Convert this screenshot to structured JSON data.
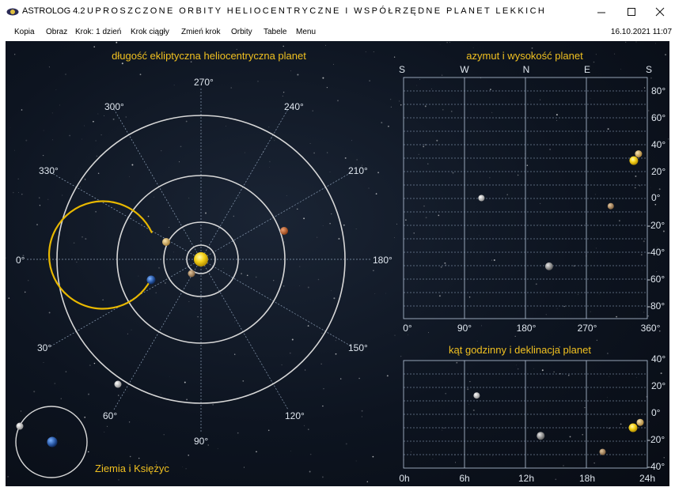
{
  "window": {
    "app_name": "ASTROLOG 4.2",
    "title": "UPROSZCZONE ORBITY HELIOCENTRYCZNE I WSPÓŁRZĘDNE PLANET LEKKICH",
    "min_icon": "minimize-icon",
    "max_icon": "maximize-icon",
    "close_icon": "close-icon"
  },
  "menu": {
    "items": [
      "Kopia",
      "Obraz",
      "Krok: 1 dzień",
      "Krok ciągły",
      "Zmień krok",
      "Orbity",
      "Tabele",
      "Menu"
    ],
    "datetime": "16.10.2021  11:07"
  },
  "colors": {
    "title_gold": "#f0c020",
    "orbit": "#d8d8d8",
    "earth_orbit": "#e8b800",
    "grid": "#9fb4d0"
  },
  "heliocentric": {
    "title": "długość ekliptyczna heliocentryczna planet",
    "angle_labels": [
      "0°",
      "30°",
      "60°",
      "90°",
      "120°",
      "150°",
      "180°",
      "210°",
      "240°",
      "270°",
      "300°",
      "330°"
    ]
  },
  "earth_moon": {
    "title": "Ziemia i Księżyc"
  },
  "azimuth": {
    "title": "azymut i wysokość planet",
    "top_labels": [
      "S",
      "W",
      "N",
      "E",
      "S"
    ],
    "x_labels": [
      "0°",
      "90°",
      "180°",
      "270°",
      "360°"
    ],
    "y_labels": [
      "80°",
      "60°",
      "40°",
      "20°",
      "0°",
      "-20°",
      "-40°",
      "-60°",
      "-80°"
    ]
  },
  "hour_angle": {
    "title": "kąt godzinny i deklinacja planet",
    "x_labels": [
      "0h",
      "6h",
      "12h",
      "18h",
      "24h"
    ],
    "y_labels": [
      "40°",
      "20°",
      "0°",
      "-20°",
      "-40°"
    ]
  },
  "chart_data": [
    {
      "type": "scatter",
      "title": "azymut i wysokość planet",
      "xlabel": "",
      "ylabel": "",
      "xlim": [
        0,
        360
      ],
      "ylim": [
        -90,
        90
      ],
      "series": [
        {
          "name": "Sun",
          "x": [
            340
          ],
          "y": [
            28
          ]
        },
        {
          "name": "Moon",
          "x": [
            115
          ],
          "y": [
            0
          ]
        },
        {
          "name": "Mercury",
          "x": [
            215
          ],
          "y": [
            -51
          ]
        },
        {
          "name": "Venus",
          "x": [
            347
          ],
          "y": [
            33
          ]
        },
        {
          "name": "Mars",
          "x": [
            306
          ],
          "y": [
            -6
          ]
        }
      ]
    },
    {
      "type": "scatter",
      "title": "kąt godzinny i deklinacja planet",
      "xlabel": "",
      "ylabel": "",
      "xlim": [
        0,
        24
      ],
      "ylim": [
        -40,
        40
      ],
      "series": [
        {
          "name": "Sun",
          "x": [
            22.6
          ],
          "y": [
            -10
          ]
        },
        {
          "name": "Moon",
          "x": [
            7.2
          ],
          "y": [
            14
          ]
        },
        {
          "name": "Mercury",
          "x": [
            13.5
          ],
          "y": [
            -16
          ]
        },
        {
          "name": "Venus",
          "x": [
            23.3
          ],
          "y": [
            -6
          ]
        },
        {
          "name": "Mars",
          "x": [
            19.6
          ],
          "y": [
            -28
          ]
        }
      ]
    }
  ]
}
